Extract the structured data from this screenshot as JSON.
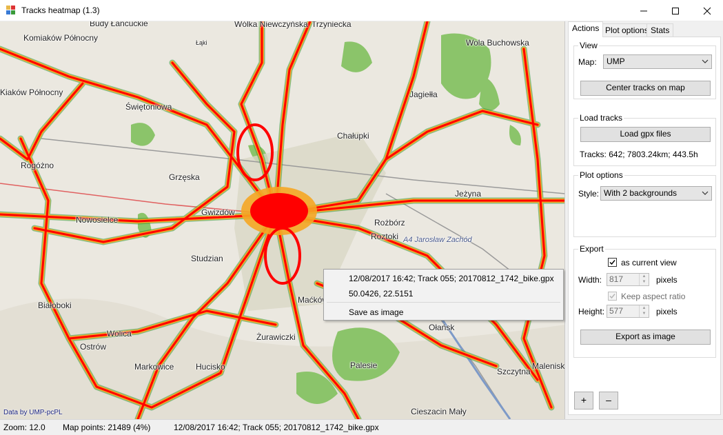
{
  "window": {
    "title": "Tracks heatmap (1.3)"
  },
  "map": {
    "labels": [
      {
        "text": "Budy Łańcuckie",
        "key": "budy"
      },
      {
        "text": "Komiaków Północny",
        "key": "komiakow"
      },
      {
        "text": "Łąki",
        "key": "laki"
      },
      {
        "text": "Wólka Niewczyńska",
        "key": "niewczynska"
      },
      {
        "text": "Trzyniecka",
        "key": "trzyniecka"
      },
      {
        "text": "Wola Buchowska",
        "key": "wola"
      },
      {
        "text": "Kiaków Północny",
        "key": "kiakow"
      },
      {
        "text": "Jagiełła",
        "key": "jagiella"
      },
      {
        "text": "Świętoniowa",
        "key": "swietoniowa"
      },
      {
        "text": "Chałupki",
        "key": "chalupki"
      },
      {
        "text": "Rogóżno",
        "key": "rogozno"
      },
      {
        "text": "Grzęska",
        "key": "grzeska"
      },
      {
        "text": "Gwizdów",
        "key": "gwizdow"
      },
      {
        "text": "Jeżyna",
        "key": "jezyna"
      },
      {
        "text": "Nowosielce",
        "key": "nowosielce"
      },
      {
        "text": "Rożbórz",
        "key": "rozborz"
      },
      {
        "text": "Roztoki",
        "key": "roztoki"
      },
      {
        "text": "Studzian",
        "key": "studzian"
      },
      {
        "text": "Maćkówka",
        "key": "mackowka"
      },
      {
        "text": "Białoboki",
        "key": "bialoboki"
      },
      {
        "text": "Wolica",
        "key": "wolica"
      },
      {
        "text": "Żurawiczki",
        "key": "zurawiczki"
      },
      {
        "text": "Ostrów",
        "key": "ostrow"
      },
      {
        "text": "Ołańsk",
        "key": "olansk"
      },
      {
        "text": "Palesie",
        "key": "palesie"
      },
      {
        "text": "Markowice",
        "key": "markowice"
      },
      {
        "text": "Hucisko",
        "key": "hucisko"
      },
      {
        "text": "Szczytna",
        "key": "szczytna"
      },
      {
        "text": "Maleniska",
        "key": "maleniska"
      },
      {
        "text": "Cieszacin Mały",
        "key": "cieszacin"
      },
      {
        "text": "A4 Jarosław Zachód",
        "key": "a4"
      }
    ],
    "attribution": "Data by UMP-pcPL"
  },
  "context_menu": {
    "line1": "12/08/2017 16:42; Track 055; 20170812_1742_bike.gpx",
    "line2": "50.0426, 22.5151",
    "save_label": "Save as image"
  },
  "tabs": [
    {
      "label": "Actions",
      "active": true
    },
    {
      "label": "Plot options",
      "active": false
    },
    {
      "label": "Stats",
      "active": false
    }
  ],
  "view_group": {
    "title": "View",
    "map_label": "Map:",
    "map_value": "UMP",
    "center_button": "Center tracks on map"
  },
  "load_group": {
    "title": "Load tracks",
    "load_button": "Load gpx files",
    "tracks_info": "Tracks: 642;  7803.24km;  443.5h"
  },
  "plot_group": {
    "title": "Plot options",
    "style_label": "Style:",
    "style_value": "With 2 backgrounds"
  },
  "export_group": {
    "title": "Export",
    "as_current_view_label": "as current view",
    "as_current_view_checked": true,
    "width_label": "Width:",
    "width_value": "817",
    "width_unit": "pixels",
    "keep_aspect_label": "Keep aspect ratio",
    "keep_aspect_checked": true,
    "height_label": "Height:",
    "height_value": "577",
    "height_unit": "pixels",
    "export_button": "Export as image"
  },
  "zoom_controls": {
    "plus": "+",
    "minus": "–"
  },
  "status": {
    "zoom": "Zoom: 12.0",
    "map_points": "Map points: 21489 (4%)",
    "track_info": "12/08/2017 16:42; Track 055; 20170812_1742_bike.gpx"
  },
  "colors": {
    "heat_core": "#ff0000",
    "heat_halo": "#f5a623",
    "heat_edge": "#3a9a3a",
    "forest": "#8bc46a",
    "map_bg": "#ebe8e0"
  }
}
